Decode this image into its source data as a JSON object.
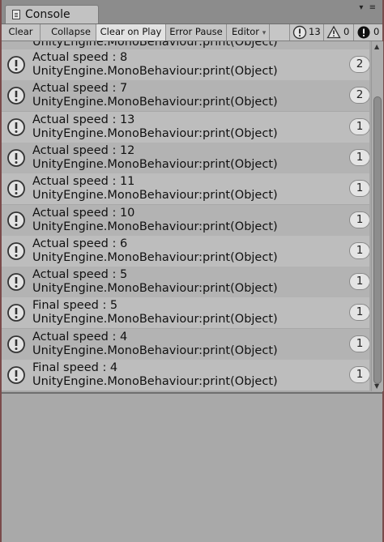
{
  "window": {
    "tab_title": "Console",
    "window_controls": "▾ ≡"
  },
  "toolbar": {
    "clear": "Clear",
    "collapse": "Collapse",
    "clear_on_play": "Clear on Play",
    "error_pause": "Error Pause",
    "editor": "Editor",
    "editor_arrow": "▾",
    "log_count": "13",
    "warning_count": "0",
    "error_count": "0",
    "icons": [
      "log-icon",
      "warning-icon",
      "error-icon"
    ]
  },
  "messages": [
    {
      "line1": "Actual speed : 8",
      "line2": "UnityEngine.MonoBehaviour:print(Object)",
      "count": "2"
    },
    {
      "line1": "Actual speed : 7",
      "line2": "UnityEngine.MonoBehaviour:print(Object)",
      "count": "2"
    },
    {
      "line1": "Actual speed : 13",
      "line2": "UnityEngine.MonoBehaviour:print(Object)",
      "count": "1"
    },
    {
      "line1": "Actual speed : 12",
      "line2": "UnityEngine.MonoBehaviour:print(Object)",
      "count": "1"
    },
    {
      "line1": "Actual speed : 11",
      "line2": "UnityEngine.MonoBehaviour:print(Object)",
      "count": "1"
    },
    {
      "line1": "Actual speed : 10",
      "line2": "UnityEngine.MonoBehaviour:print(Object)",
      "count": "1"
    },
    {
      "line1": "Actual speed : 6",
      "line2": "UnityEngine.MonoBehaviour:print(Object)",
      "count": "1"
    },
    {
      "line1": "Actual speed : 5",
      "line2": "UnityEngine.MonoBehaviour:print(Object)",
      "count": "1"
    },
    {
      "line1": "Final speed : 5",
      "line2": "UnityEngine.MonoBehaviour:print(Object)",
      "count": "1"
    },
    {
      "line1": "Actual speed : 4",
      "line2": "UnityEngine.MonoBehaviour:print(Object)",
      "count": "1"
    },
    {
      "line1": "Final speed : 4",
      "line2": "UnityEngine.MonoBehaviour:print(Object)",
      "count": "1"
    }
  ],
  "partial_row": {
    "line2": "UnityEngine.MonoBehaviour:print(Object)"
  },
  "colors": {
    "row_light": "#bdbdbd",
    "row_dark": "#b3b3b3",
    "toolbar": "#c6c6c6",
    "error_badge": "#111111"
  }
}
